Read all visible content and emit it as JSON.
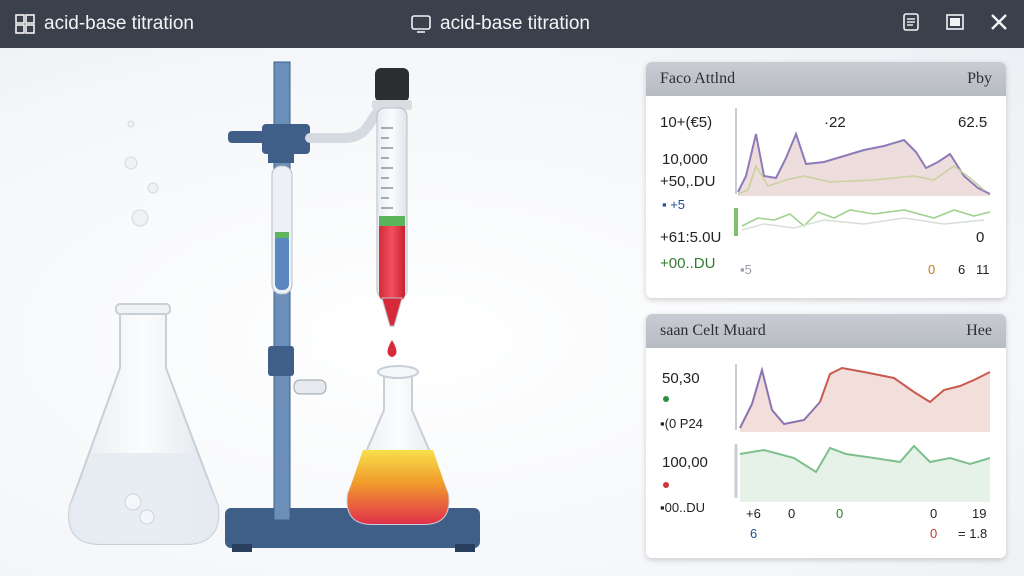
{
  "window": {
    "left_title": "acid-base titration",
    "center_title": "acid-base titration",
    "icons": {
      "app": "app-grid-icon",
      "center": "monitor-icon",
      "doc": "document-icon",
      "restore": "restore-icon",
      "close": "close-icon"
    }
  },
  "panel1": {
    "header_left": "Faco Attlnd",
    "header_right": "Pby",
    "labels": {
      "a": "10+(€5)",
      "b": "10,000",
      "c": "+50,.DU",
      "d": "▪ +5",
      "e": "+61:5.0U",
      "f": "+00..DU",
      "g": "·22",
      "h": "62.5",
      "i": "0",
      "j": "▪5",
      "k": "0",
      "l": "6",
      "m": "11"
    },
    "colors": {
      "purple": "#8f7ab8",
      "fill": "#e8d6d6",
      "green": "#8cc07a"
    }
  },
  "panel2": {
    "header_left": "saan Celt Muard",
    "header_right": "Hee",
    "labels": {
      "a": "50,30",
      "b": "▪(0 P24",
      "c": "100,00",
      "d": "▪00..DU",
      "e": "+6",
      "f": "0",
      "g": "0",
      "h": "0",
      "i": "19",
      "j": "6",
      "k": "0",
      "l": "= 1.8"
    },
    "colors": {
      "purple": "#8a73b0",
      "red": "#c95a4f",
      "green": "#7dbf8d"
    }
  }
}
